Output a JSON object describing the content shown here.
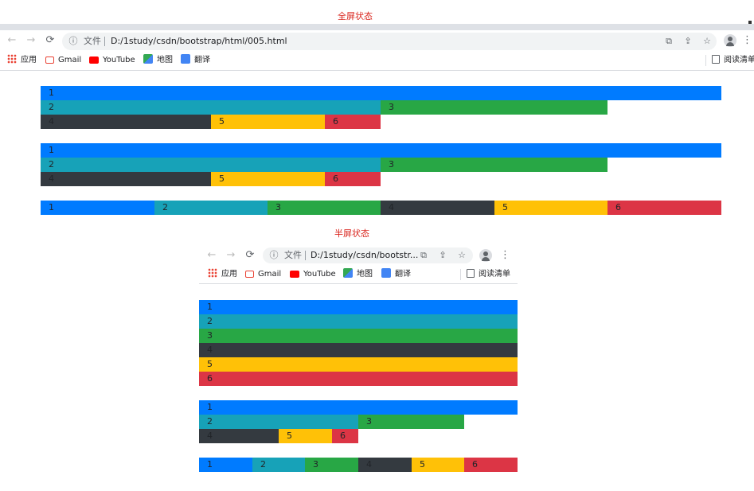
{
  "captions": {
    "full": "全屏状态",
    "half": "半屏状态"
  },
  "browser": {
    "back_icon": "←",
    "forward_icon": "→",
    "reload_icon": "⟳",
    "info_icon": "ⓘ",
    "file_label": "文件",
    "url": "D:/1study/csdn/bootstrap/html/005.html",
    "url_truncated": "D:/1study/csdn/bootstr...",
    "translate_icon": "⧉",
    "share_icon": "⇪",
    "star_icon": "☆",
    "menu_icon": "⋮",
    "profile_icon": "●",
    "bookmarks": {
      "apps": "应用",
      "gmail": "Gmail",
      "youtube": "YouTube",
      "maps": "地图",
      "translate": "翻译",
      "reading_list": "阅读清单",
      "reading_list_truncated": "阅读清单"
    }
  },
  "colors": {
    "blue": "#007bff",
    "teal": "#17a2b8",
    "green": "#28a745",
    "dark": "#343a40",
    "yellow": "#ffc107",
    "red": "#dc3545",
    "caption": "#d9251d"
  },
  "bars": {
    "b1": "1",
    "b2": "2",
    "b3": "3",
    "b4": "4",
    "b5": "5",
    "b6": "6"
  }
}
